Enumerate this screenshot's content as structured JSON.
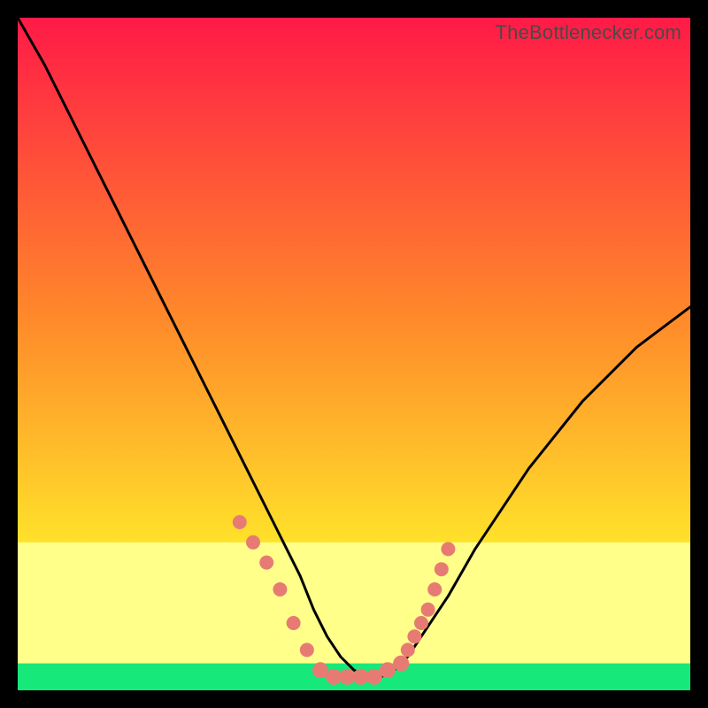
{
  "watermark": "TheBottlenecker.com",
  "colors": {
    "top": "#ff1a47",
    "mid1": "#ff8a2a",
    "mid2": "#ffe12a",
    "band": "#ffff8a",
    "bottom": "#17e87a",
    "curve": "#000000",
    "marker": "#e77b74",
    "frame": "#000000"
  },
  "chart_data": {
    "type": "line",
    "title": "",
    "xlabel": "",
    "ylabel": "",
    "xlim": [
      0,
      100
    ],
    "ylim": [
      0,
      100
    ],
    "curve": {
      "x": [
        0,
        4,
        8,
        12,
        16,
        20,
        24,
        28,
        32,
        36,
        38,
        40,
        42,
        44,
        46,
        48,
        50,
        52,
        54,
        56,
        58,
        60,
        64,
        68,
        72,
        76,
        80,
        84,
        88,
        92,
        96,
        100
      ],
      "y": [
        100,
        93,
        85,
        77,
        69,
        61,
        53,
        45,
        37,
        29,
        25,
        21,
        17,
        12,
        8,
        5,
        3,
        2,
        2,
        3,
        5,
        8,
        14,
        21,
        27,
        33,
        38,
        43,
        47,
        51,
        54,
        57
      ]
    },
    "markers_left": {
      "x": [
        33,
        35,
        37,
        39,
        41,
        43
      ],
      "y": [
        25,
        22,
        19,
        15,
        10,
        6
      ]
    },
    "markers_floor": {
      "x": [
        45,
        47,
        49,
        51,
        53,
        55,
        57
      ],
      "y": [
        3,
        2,
        2,
        2,
        2,
        3,
        4
      ]
    },
    "markers_right": {
      "x": [
        58,
        59,
        60,
        61,
        62,
        63,
        64
      ],
      "y": [
        6,
        8,
        10,
        12,
        15,
        18,
        21
      ]
    },
    "bands": {
      "pale_yellow_top": 22,
      "green_top": 4
    }
  }
}
